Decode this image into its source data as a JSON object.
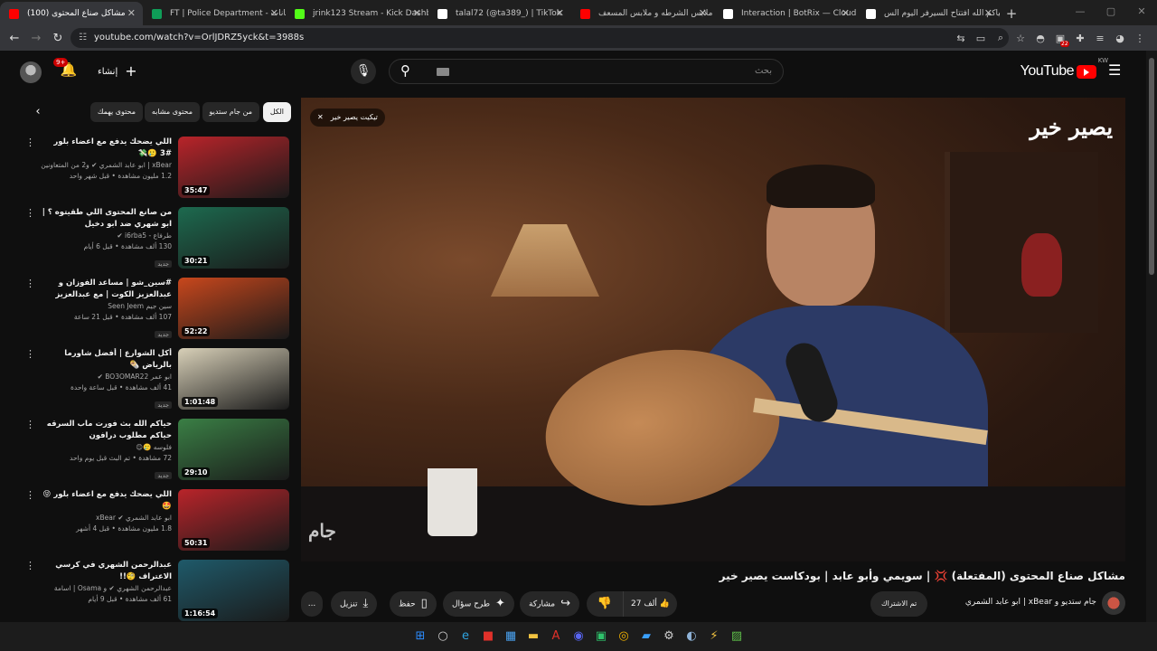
{
  "browser": {
    "tabs": [
      {
        "label": "(100) مشاكل صناع المحتوى",
        "color": "#ff0000",
        "active": true
      },
      {
        "label": "FT | Police Department - بيانات",
        "color": "#0f9d58",
        "active": false
      },
      {
        "label": "jrink123 Stream - Kick Dashboard",
        "color": "#53fc18",
        "active": false
      },
      {
        "label": "talal72 (@ta389_) | TikTok",
        "color": "#ffffff",
        "active": false
      },
      {
        "label": "ملابس الشرطه و ملابس المسعف",
        "color": "#ff0000",
        "active": false
      },
      {
        "label": "Interaction | BotRix — Cloud St",
        "color": "#ffffff",
        "active": false
      },
      {
        "label": "حياكم الله افتتاح السيرفر اليوم الس",
        "color": "#ffffff",
        "active": false
      }
    ],
    "new_tab": "+",
    "url": "youtube.com/watch?v=OrlJDRZ5yck&t=3988s",
    "address_icons": [
      "translate-icon",
      "cast-icon",
      "zoom-icon",
      "star-icon",
      "incognito-icon",
      "extension-badge-icon",
      "puzzle-icon",
      "menu-icon",
      "profile-icon",
      "more-icon"
    ],
    "extension_badge": "22"
  },
  "header": {
    "logo_text": "YouTube",
    "country_code": "KW",
    "search_placeholder": "بحث",
    "create_label": "إنشاء",
    "notif_count": "9+"
  },
  "video": {
    "chip_text": "تيكيت يصير خير",
    "brand_overlay": "يصير خير",
    "watermark": "جام",
    "title": "مشاكل صناع المحتوى (المفتعلة) 💢 | سويمي وأبو عابد | بودكاست يصير خير",
    "channel": "جام ستديو و xBear | ابو عابد الشمري",
    "subscribe": "تم الاشتراك",
    "likes": "27 ألف",
    "share": "مشاركة",
    "ask": "طرح سؤال",
    "save": "حفظ",
    "download": "تنزيل",
    "more": "..."
  },
  "chips": {
    "items": [
      "الكل",
      "من جام ستديو",
      "محتوى مشابه",
      "محتوى يهمك"
    ],
    "selected": "الكل"
  },
  "recs": [
    {
      "title": "اللي يضحك يدفع مع اعضاء بلور #3 🥲💸",
      "channel": "xBear | ابو عابد الشمري ✔ و2 من المتعاونين الآخرين",
      "views": "1.2 مليون مشاهدة • قبل شهر واحد",
      "duration": "35:47",
      "is_new": false,
      "thumb_color": "#b9242a"
    },
    {
      "title": "من صانع المحتوى اللي طقيتوه ؟ | ابو شهري ضد ابو دخيل",
      "channel": "طرفاع - i6rba5 ✔",
      "views": "130 ألف مشاهدة • قبل 6 أيام",
      "duration": "30:21",
      "is_new": true,
      "thumb_color": "#1d6a4f"
    },
    {
      "title": "#سين_شو | مساعد الفوزان و عبدالعزيز الكوت | مع عبدالعزيز السماك",
      "channel": "سين جيم Seen Jeem",
      "views": "107 ألف مشاهدة • قبل 21 ساعة",
      "duration": "52:22",
      "is_new": true,
      "thumb_color": "#c8471c"
    },
    {
      "title": "أكل الشوارع | أفضل شاورما بالرياض 🌯",
      "channel": "ابو عمر BO3OMAR22 ✔",
      "views": "41 ألف مشاهدة • قبل ساعة واحدة",
      "duration": "1:01:48",
      "is_new": true,
      "thumb_color": "#d8d0b8"
    },
    {
      "title": "حياكم الله بث فورت ماب السرقه حياكم مطلوب درافون",
      "channel": "فلوسه 🥲😊",
      "views": "72 مشاهدة • تم البث قبل يوم واحد",
      "duration": "29:10",
      "is_new": true,
      "thumb_color": "#3a7f45"
    },
    {
      "title": "اللي يضحك يدفع مع اعضاء بلور 😝🤩",
      "channel": "ابو عابد الشمري ✔ xBear",
      "views": "1.8 مليون مشاهدة • قبل 4 أشهر",
      "duration": "50:31",
      "is_new": false,
      "thumb_color": "#b9242a"
    },
    {
      "title": "عبدالرحمن الشهري في كرسي الاعتراف 🧐!!",
      "channel": "عبدالرحمن الشهري ✔ و Osama | اسامة",
      "views": "61 ألف مشاهدة • قبل 9 أيام",
      "duration": "1:16:54",
      "is_new": false,
      "thumb_color": "#1f5a6a"
    }
  ],
  "new_badge": "جديد",
  "taskbar": {
    "icons": [
      {
        "name": "windows-start-icon",
        "glyph": "⊞",
        "color": "#2b8cff"
      },
      {
        "name": "search-icon",
        "glyph": "○",
        "color": "#cfcfcf"
      },
      {
        "name": "edge-icon",
        "glyph": "e",
        "color": "#2ea3e0"
      },
      {
        "name": "app-red-icon",
        "glyph": "■",
        "color": "#e0312a"
      },
      {
        "name": "store-icon",
        "glyph": "▦",
        "color": "#4aa3f2"
      },
      {
        "name": "file-explorer-icon",
        "glyph": "▬",
        "color": "#f2c341"
      },
      {
        "name": "adobe-icon",
        "glyph": "A",
        "color": "#e0312a"
      },
      {
        "name": "discord-icon",
        "glyph": "◉",
        "color": "#5865f2"
      },
      {
        "name": "green-app-icon",
        "glyph": "▣",
        "color": "#2fc26b"
      },
      {
        "name": "chrome-icon",
        "glyph": "◎",
        "color": "#f4b400"
      },
      {
        "name": "editor-icon",
        "glyph": "▰",
        "color": "#3aa0ff"
      },
      {
        "name": "settings-icon",
        "glyph": "⚙",
        "color": "#cfcfcf"
      },
      {
        "name": "steam-icon",
        "glyph": "◐",
        "color": "#8fb3d8"
      },
      {
        "name": "lightning-app-icon",
        "glyph": "⚡",
        "color": "#f2c341"
      },
      {
        "name": "game-icon",
        "glyph": "▨",
        "color": "#5fbf4a"
      }
    ]
  }
}
